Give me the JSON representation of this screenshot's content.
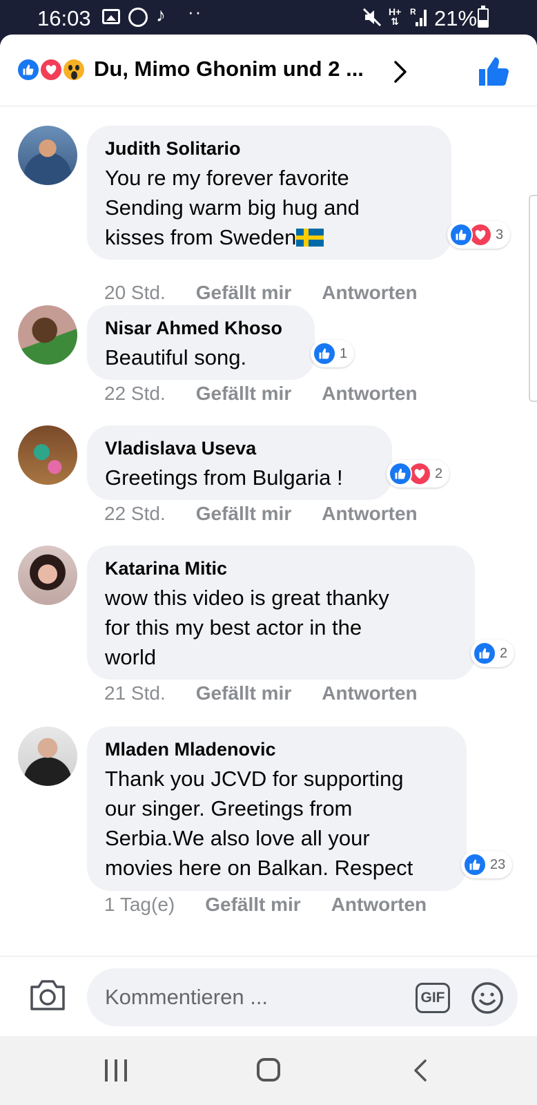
{
  "status_bar": {
    "time": "16:03",
    "network": "H+",
    "roaming": "R",
    "battery": "21%",
    "icons": [
      "gallery-icon",
      "whatsapp-icon",
      "tiktok-icon",
      "more-notifications-icon",
      "mute-icon",
      "signal-icon",
      "battery-icon"
    ]
  },
  "header": {
    "reactions": [
      "like",
      "love",
      "wow"
    ],
    "title": "Du, Mimo Ghonim und 2 ...",
    "like_icon": "thumbs-up-icon"
  },
  "comments": [
    {
      "author": "Judith Solitario",
      "lines": [
        "You re my forever favorite",
        "Sending warm big hug and",
        "kisses from Sweden"
      ],
      "flag": "sweden-flag",
      "reactions": [
        "like",
        "love"
      ],
      "reaction_count": "3",
      "time": "20 Std.",
      "like_label": "Gefällt mir",
      "reply_label": "Antworten"
    },
    {
      "author": "Nisar Ahmed Khoso",
      "lines": [
        "Beautiful song."
      ],
      "reactions": [
        "like"
      ],
      "reaction_count": "1",
      "time": "22 Std.",
      "like_label": "Gefällt mir",
      "reply_label": "Antworten"
    },
    {
      "author": "Vladislava Useva",
      "lines": [
        "Greetings from Bulgaria !"
      ],
      "reactions": [
        "like",
        "love"
      ],
      "reaction_count": "2",
      "time": "22 Std.",
      "like_label": "Gefällt mir",
      "reply_label": "Antworten"
    },
    {
      "author": "Katarina Mitic",
      "lines": [
        "wow this video is great thanky",
        "for this my best actor in the",
        "world"
      ],
      "reactions": [
        "like"
      ],
      "reaction_count": "2",
      "time": "21 Std.",
      "like_label": "Gefällt mir",
      "reply_label": "Antworten"
    },
    {
      "author": "Mladen Mladenovic",
      "lines": [
        "Thank you JCVD for supporting",
        "our singer. Greetings from",
        "Serbia.We also love all your",
        "movies here on Balkan. Respect"
      ],
      "reactions": [
        "like"
      ],
      "reaction_count": "23",
      "time": "1 Tag(e)",
      "like_label": "Gefällt mir",
      "reply_label": "Antworten"
    }
  ],
  "composer": {
    "placeholder": "Kommentieren ...",
    "gif_label": "GIF"
  },
  "colors": {
    "status_bar": "#1b1f35",
    "facebook_blue": "#1877f2",
    "love_red": "#f33e58",
    "bubble_bg": "#f0f2f5",
    "meta_gray": "#8a8d91"
  }
}
